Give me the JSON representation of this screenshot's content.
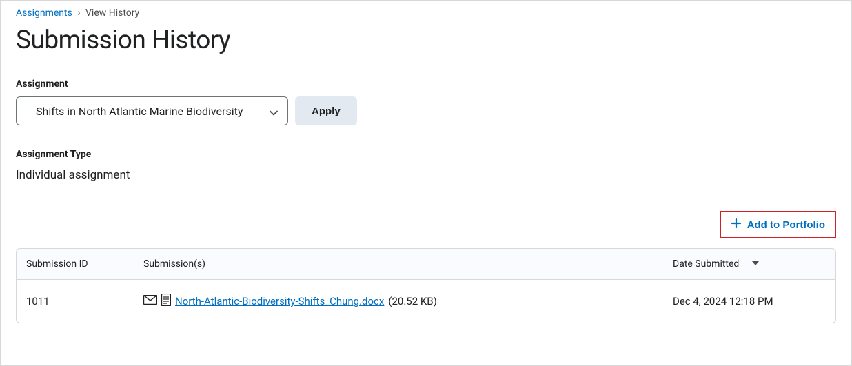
{
  "breadcrumb": {
    "parent": "Assignments",
    "current": "View History"
  },
  "page_title": "Submission History",
  "filter": {
    "label": "Assignment",
    "selected": "Shifts in North Atlantic Marine Biodiversity",
    "apply_label": "Apply"
  },
  "assignment_type": {
    "label": "Assignment Type",
    "value": "Individual assignment"
  },
  "portfolio_button": "Add to Portfolio",
  "table": {
    "headers": {
      "id": "Submission ID",
      "submissions": "Submission(s)",
      "date": "Date Submitted"
    },
    "row": {
      "id": "1011",
      "filename": "North-Atlantic-Biodiversity-Shifts_Chung.docx",
      "filesize": "(20.52 KB)",
      "date": "Dec 4, 2024 12:18 PM"
    }
  }
}
